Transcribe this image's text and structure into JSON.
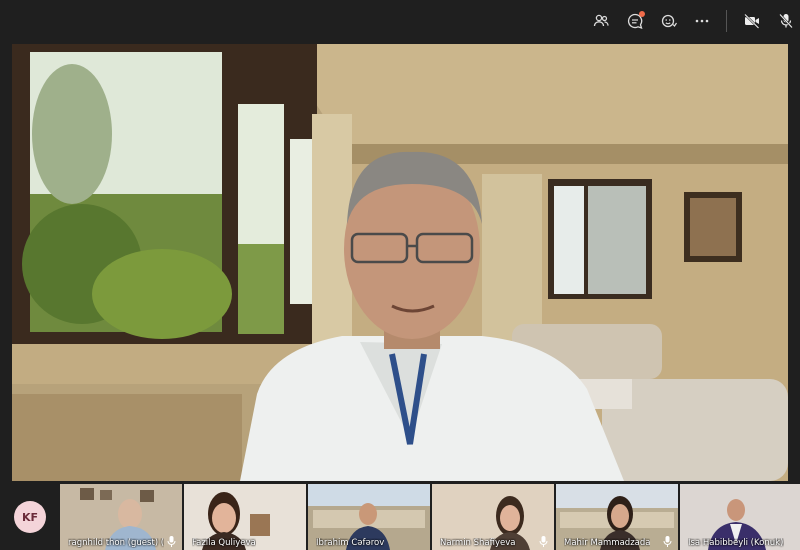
{
  "toolbar": {
    "icons": [
      "participants-icon",
      "chat-icon",
      "reactions-icon",
      "more-icon",
      "camera-off-icon",
      "mic-off-icon"
    ],
    "chat_notification_color": "#f06b4a"
  },
  "main_video": {
    "speaker": "",
    "description_colors": {
      "wall": "#c9b48a",
      "window_light": "#e8efe0",
      "shirt": "#f2f2f2"
    }
  },
  "participants": [
    {
      "initials": "KF",
      "kind": "avatar"
    },
    {
      "name": "ragnhild thon (guest) (...",
      "kind": "video"
    },
    {
      "name": "Fazila Quliyeva",
      "kind": "video"
    },
    {
      "name": "İbrahim Cəfərov",
      "kind": "video"
    },
    {
      "name": "Narmin Shafiyeva",
      "kind": "video"
    },
    {
      "name": "Mahir Mammadzada",
      "kind": "video"
    },
    {
      "name": "Isa Habibbeyli (Konuk)...",
      "kind": "video"
    }
  ],
  "colors": {
    "background": "#1f1f1f",
    "avatar_bg": "#f4d4d9",
    "avatar_text": "#6b2b3a"
  }
}
